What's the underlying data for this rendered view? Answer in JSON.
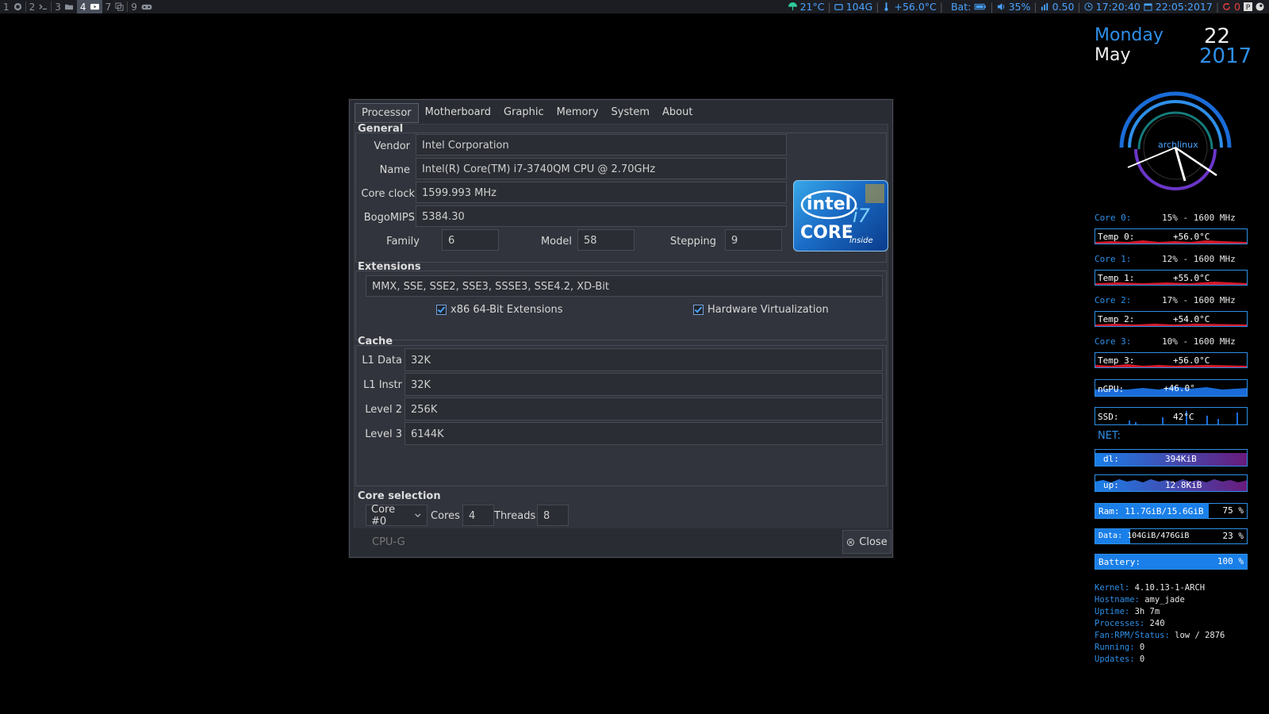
{
  "topbar": {
    "workspaces": [
      {
        "num": "1",
        "icon": "firefox-icon"
      },
      {
        "num": "2",
        "icon": "terminal-icon"
      },
      {
        "num": "3",
        "icon": "folder-icon"
      },
      {
        "num": "4",
        "icon": "video-icon",
        "active": true
      },
      {
        "num": "7",
        "icon": "window-icon"
      },
      {
        "num": "9",
        "icon": "gamepad-icon"
      }
    ],
    "status": {
      "weather": "21°C",
      "disk": "104G",
      "temp": "+56.0°C",
      "battery_label": "Bat:",
      "volume": "35%",
      "load": "0.50",
      "time": "17:20:40",
      "date": "22:05:2017",
      "updates": "0"
    }
  },
  "dialog": {
    "tabs": [
      "Processor",
      "Motherboard",
      "Graphic",
      "Memory",
      "System",
      "About"
    ],
    "general": {
      "title": "General",
      "vendor_label": "Vendor",
      "vendor": "Intel Corporation",
      "name_label": "Name",
      "name": "Intel(R) Core(TM) i7-3740QM CPU @ 2.70GHz",
      "clock_label": "Core clock",
      "clock": "1599.993 MHz",
      "bogomips_label": "BogoMIPS",
      "bogomips": "5384.30",
      "family_label": "Family",
      "family": "6",
      "model_label": "Model",
      "model": "58",
      "stepping_label": "Stepping",
      "stepping": "9"
    },
    "logo": {
      "brand": "intel",
      "series": "i7",
      "line": "CORE",
      "sub": "inside",
      "tm": "™"
    },
    "extensions": {
      "title": "Extensions",
      "value": "MMX, SSE, SSE2, SSE3, SSSE3, SSE4.2, XD-Bit",
      "x86_64": "x86 64-Bit Extensions",
      "virt": "Hardware Virtualization"
    },
    "cache": {
      "title": "Cache",
      "rows": [
        {
          "label": "L1 Data",
          "value": "32K"
        },
        {
          "label": "L1 Instr",
          "value": "32K"
        },
        {
          "label": "Level 2",
          "value": "256K"
        },
        {
          "label": "Level 3",
          "value": "6144K"
        }
      ]
    },
    "core_selection": {
      "title": "Core selection",
      "core": "Core #0",
      "cores_label": "Cores",
      "cores": "4",
      "threads_label": "Threads",
      "threads": "8"
    },
    "footer": {
      "brand": "CPU-G",
      "close": "Close"
    }
  },
  "conky": {
    "day": "Monday",
    "month": "May",
    "date": "22",
    "year": "2017",
    "clock_logo": "archlinux",
    "cores": [
      {
        "label": "Core 0:",
        "usage": "15% - 1600 MHz",
        "temp_label": "Temp 0:",
        "temp": "+56.0°C"
      },
      {
        "label": "Core 1:",
        "usage": "12% - 1600 MHz",
        "temp_label": "Temp 1:",
        "temp": "+55.0°C"
      },
      {
        "label": "Core 2:",
        "usage": "17% - 1600 MHz",
        "temp_label": "Temp 2:",
        "temp": "+54.0°C"
      },
      {
        "label": "Core 3:",
        "usage": "10% - 1600 MHz",
        "temp_label": "Temp 3:",
        "temp": "+56.0°C"
      }
    ],
    "gpu_label": "nGPU:",
    "gpu_temp": "+46.0°",
    "ssd_label": "SSD:",
    "ssd_temp": "42°C",
    "net_title": "NET:",
    "dl_label": "dl:",
    "dl": "394KiB",
    "up_label": "up:",
    "up": "12.8KiB",
    "ram": {
      "label": "Ram:  11.7GiB/15.6GiB",
      "pct": "75 %",
      "fraction": 0.75
    },
    "data": {
      "label": "Data: 104GiB/476GiB",
      "pct": "23 %",
      "fraction": 0.23
    },
    "battery": {
      "label": "Battery:",
      "pct": "100 %",
      "fraction": 1.0
    },
    "info": [
      {
        "key": "Kernel:",
        "val": "4.10.13-1-ARCH"
      },
      {
        "key": "Hostname:",
        "val": "amy_jade"
      },
      {
        "key": "Uptime:",
        "val": "3h 7m"
      },
      {
        "key": "Processes:",
        "val": "240"
      },
      {
        "key": "Fan:RPM/Status:",
        "val": "low / 2876"
      },
      {
        "key": "Running:",
        "val": "0"
      },
      {
        "key": "Updates:",
        "val": "0"
      }
    ]
  }
}
